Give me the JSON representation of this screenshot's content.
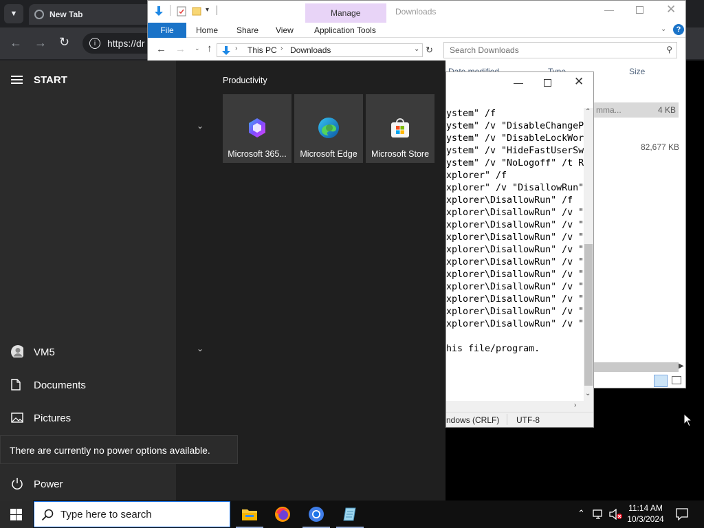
{
  "browser": {
    "tab_title": "New Tab",
    "address": "https://dr"
  },
  "explorer": {
    "title": "Downloads",
    "ribbon_context": "Manage",
    "tabs": [
      "File",
      "Home",
      "Share",
      "View",
      "Application Tools"
    ],
    "breadcrumb": [
      "This PC",
      "Downloads"
    ],
    "search_placeholder": "Search Downloads",
    "columns": [
      "Date modified",
      "Type",
      "Size"
    ],
    "rows": [
      {
        "type": "mma...",
        "size": "4 KB"
      },
      {
        "type": "",
        "size": "82,677 KB"
      }
    ]
  },
  "notepad": {
    "lines": [
      "ystem\" /f",
      "ystem\" /v \"DisableChangeP",
      "ystem\" /v \"DisableLockWor",
      "ystem\" /v \"HideFastUserSw",
      "ystem\" /v \"NoLogoff\" /t R",
      "xplorer\" /f",
      "xplorer\" /v \"DisallowRun\"",
      "xplorer\\DisallowRun\" /f",
      "xplorer\\DisallowRun\" /v \"",
      "xplorer\\DisallowRun\" /v \"",
      "xplorer\\DisallowRun\" /v \"",
      "xplorer\\DisallowRun\" /v \"",
      "xplorer\\DisallowRun\" /v \"",
      "xplorer\\DisallowRun\" /v \"",
      "xplorer\\DisallowRun\" /v \"",
      "xplorer\\DisallowRun\" /v \"",
      "xplorer\\DisallowRun\" /v \"",
      "xplorer\\DisallowRun\" /v \"",
      "",
      "his file/program."
    ],
    "status_line_ending": "ndows (CRLF)",
    "status_encoding": "UTF-8"
  },
  "start": {
    "title": "START",
    "group_title": "Productivity",
    "tiles": [
      {
        "label": "Microsoft 365...",
        "icon": "m365-icon"
      },
      {
        "label": "Microsoft Edge",
        "icon": "edge-icon"
      },
      {
        "label": "Microsoft Store",
        "icon": "store-icon"
      }
    ],
    "rail": {
      "user": "VM5",
      "documents": "Documents",
      "pictures": "Pictures",
      "power": "Power"
    },
    "power_tooltip": "There are currently no power options available."
  },
  "taskbar": {
    "search_placeholder": "Type here to search",
    "time": "11:14 AM",
    "date": "10/3/2024"
  }
}
